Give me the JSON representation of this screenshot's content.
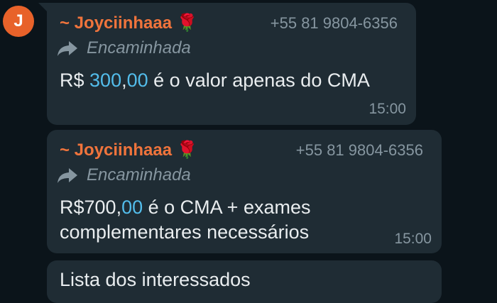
{
  "avatar": {
    "letter": "J",
    "color": "#e8622a"
  },
  "messages": [
    {
      "sender": "~ Joyciinhaaa 🌹",
      "phone": "+55 81 9804-6356",
      "forwarded_label": "Encaminhada",
      "text_parts": [
        "R$ ",
        "300",
        ",",
        "00",
        " é o valor apenas do CMA"
      ],
      "time": "15:00"
    },
    {
      "sender": "~ Joyciinhaaa 🌹",
      "phone": "+55 81 9804-6356",
      "forwarded_label": "Encaminhada",
      "text_parts": [
        "R$700,",
        "00",
        " é o CMA + exames",
        "complementares necessários"
      ],
      "time": "15:00"
    },
    {
      "text": "Lista dos interessados"
    }
  ],
  "colors": {
    "sender": "#f0743c",
    "link": "#53bdeb",
    "bubble": "#1f2c34",
    "background": "#0b141a"
  }
}
